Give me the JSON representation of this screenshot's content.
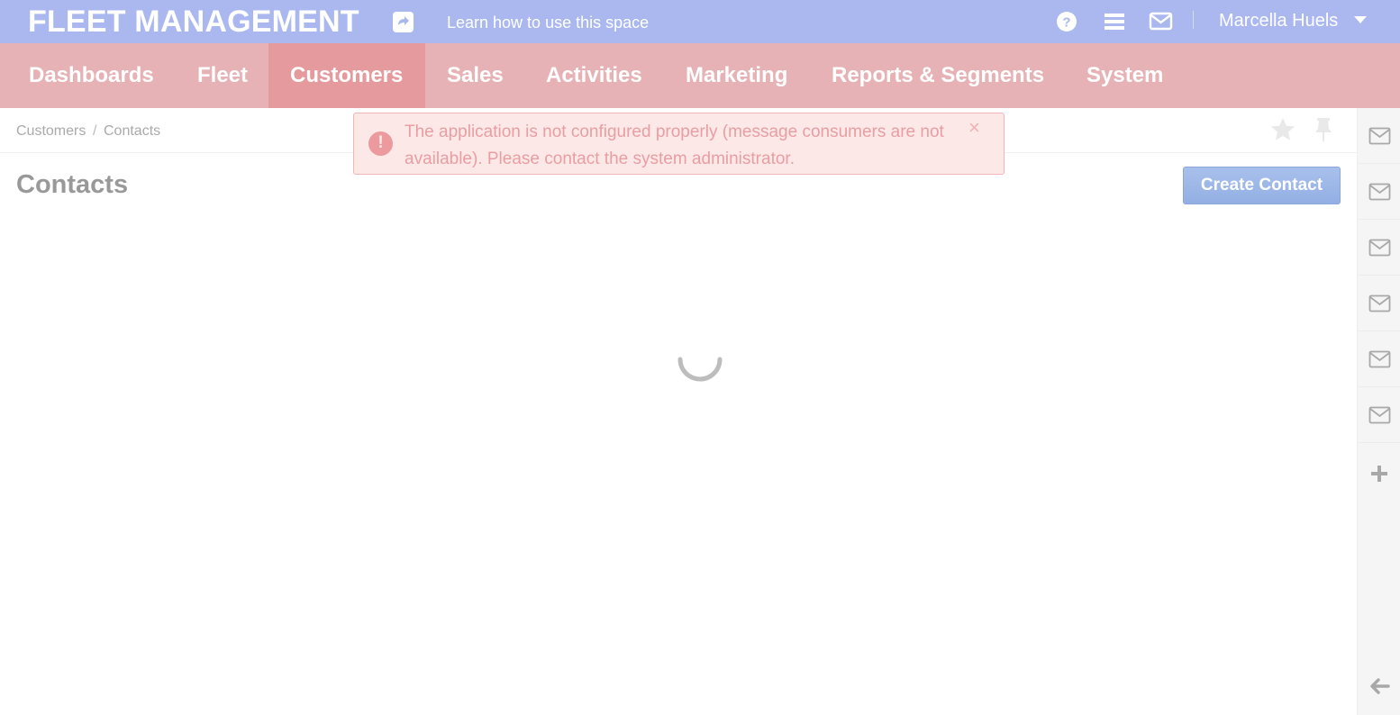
{
  "header": {
    "app_title": "FLEET MANAGEMENT",
    "learn_link": "Learn how to use this space",
    "user_name": "Marcella Huels",
    "icons": [
      "share-icon",
      "help-icon",
      "menu-icon",
      "envelope-icon",
      "caret-down-icon"
    ]
  },
  "nav": {
    "items": [
      "Dashboards",
      "Fleet",
      "Customers",
      "Sales",
      "Activities",
      "Marketing",
      "Reports & Segments",
      "System"
    ],
    "active": "Customers"
  },
  "breadcrumb": {
    "parent": "Customers",
    "separator": "/",
    "current": "Contacts"
  },
  "page": {
    "title": "Contacts",
    "create_button": "Create Contact"
  },
  "alert": {
    "message": "The application is not configured properly (message consumers are not available). Please contact the system administrator.",
    "close": "×"
  },
  "sidebar": {
    "icons": [
      "envelope-icon",
      "envelope-icon",
      "envelope-icon",
      "envelope-icon",
      "envelope-icon",
      "envelope-icon",
      "plus-icon",
      "arrow-left-icon"
    ]
  },
  "colors": {
    "header_bg": "#aab8ef",
    "nav_bg": "#e6b2b5",
    "nav_active_bg": "#e59a9e",
    "alert_bg": "#fde8e8",
    "alert_text": "#e89ea2",
    "button_bg": "#a8c0ec"
  }
}
